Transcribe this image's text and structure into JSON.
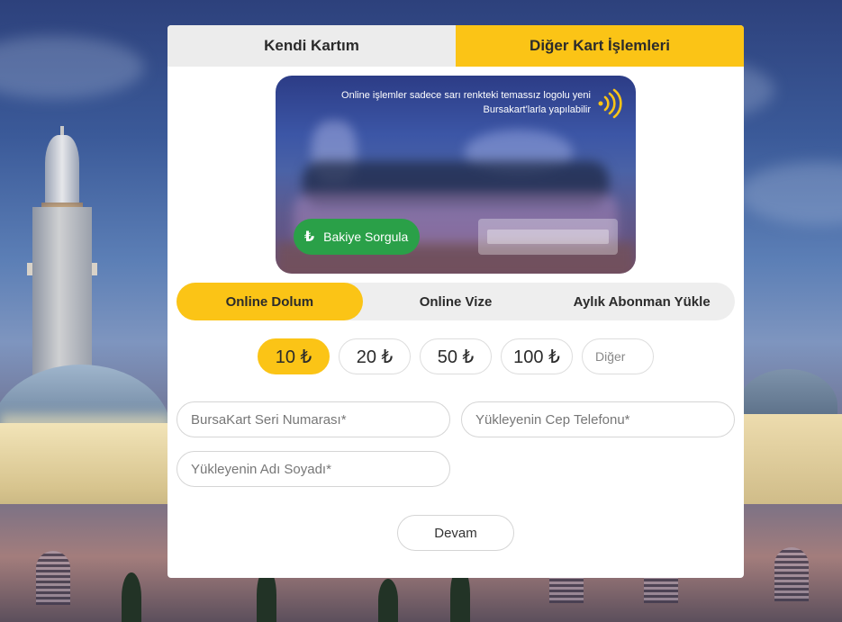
{
  "top_tabs": [
    {
      "label": "Kendi Kartım",
      "active": false
    },
    {
      "label": "Diğer Kart İşlemleri",
      "active": true
    }
  ],
  "card": {
    "info_text": "Online işlemler sadece sarı renkteki temassız logolu yeni Bursakart'larla yapılabilir",
    "balance_button_icon": "₺",
    "balance_button_label": "Bakiye Sorgula"
  },
  "sub_tabs": [
    {
      "label": "Online Dolum",
      "active": true
    },
    {
      "label": "Online Vize",
      "active": false
    },
    {
      "label": "Aylık Abonman Yükle",
      "active": false
    }
  ],
  "amounts": [
    {
      "label": "10 ₺",
      "active": true
    },
    {
      "label": "20 ₺",
      "active": false
    },
    {
      "label": "50 ₺",
      "active": false
    },
    {
      "label": "100 ₺",
      "active": false
    }
  ],
  "amount_other_placeholder": "Diğer",
  "form": {
    "serial_placeholder": "BursaKart Seri Numarası*",
    "phone_placeholder": "Yükleyenin Cep Telefonu*",
    "name_placeholder": "Yükleyenin Adı Soyadı*",
    "continue_label": "Devam"
  },
  "colors": {
    "accent": "#fbc416",
    "balance_button": "#2aa048",
    "inactive_tab": "#ececec"
  },
  "icons": {
    "contactless": "contactless-icon",
    "lira": "lira-icon"
  }
}
